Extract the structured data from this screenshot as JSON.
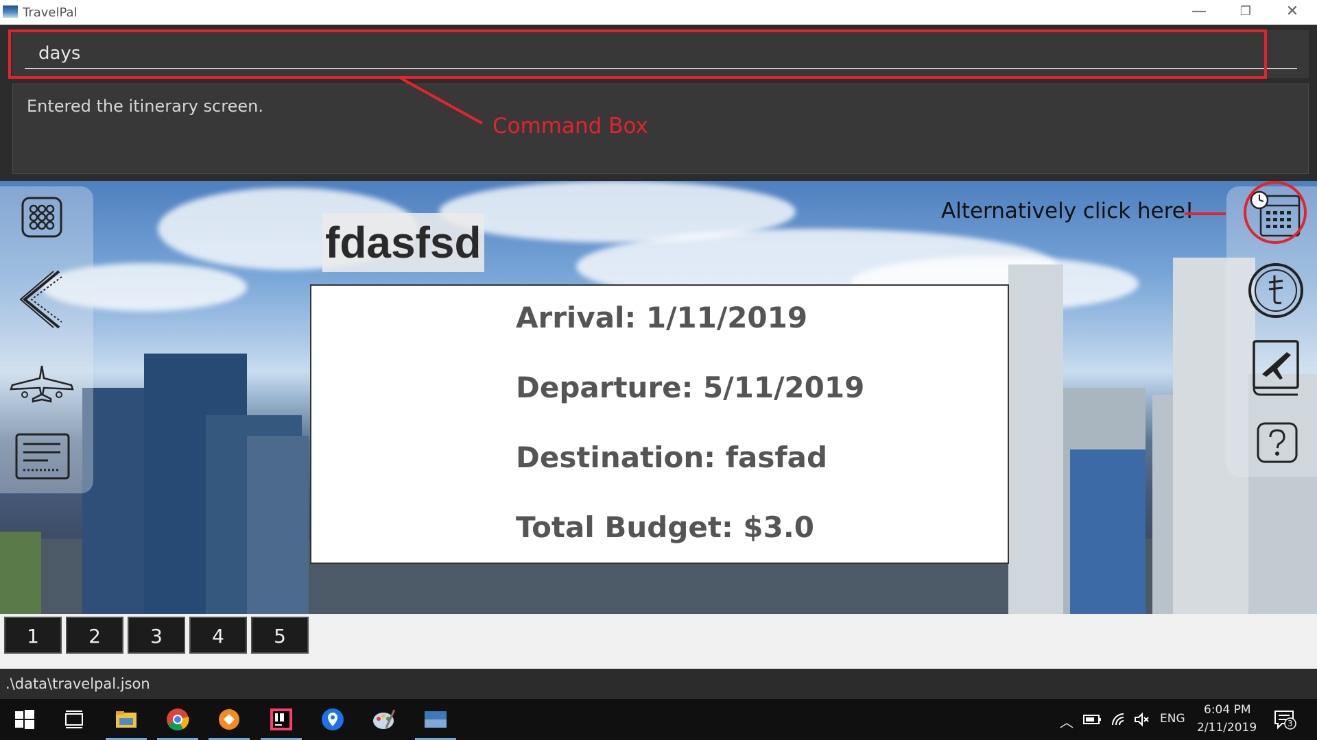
{
  "window": {
    "title": "TravelPal",
    "minimize": "—",
    "restore": "❐",
    "close": "✕"
  },
  "command": {
    "input_value": "days",
    "result_text": "Entered the itinerary screen."
  },
  "annotations": {
    "command_box_label": "Command Box",
    "alternative_label": "Alternatively click here!",
    "color": "#e5232b"
  },
  "trip": {
    "name": "fdasfsd",
    "arrival": "Arrival: 1/11/2019",
    "departure": "Departure: 5/11/2019",
    "destination": "Destination: fasfad",
    "budget": "Total Budget: $3.0"
  },
  "left_nav": {
    "icons": [
      "grid-icon",
      "back-arrow-icon",
      "airplane-icon",
      "list-icon"
    ]
  },
  "right_nav": {
    "icons": [
      "calendar-clock-icon",
      "currency-icon",
      "flight-book-icon",
      "help-icon"
    ]
  },
  "day_tabs": [
    "1",
    "2",
    "3",
    "4",
    "5"
  ],
  "status": {
    "path": ".\\data\\travelpal.json"
  },
  "taskbar": {
    "apps": [
      "windows-start-icon",
      "task-view-icon",
      "file-explorer-icon",
      "chrome-icon",
      "app-orange-icon",
      "intellij-icon",
      "maps-icon",
      "paint-icon",
      "travelpal-icon"
    ],
    "language": "ENG",
    "time": "6:04 PM",
    "date": "2/11/2019",
    "notification_count": "3"
  },
  "colors": {
    "command_bg": "#2c2c2c",
    "field_bg": "#383838",
    "accent_red": "#e5232b",
    "day_tab_bg": "#1c1c1c"
  }
}
